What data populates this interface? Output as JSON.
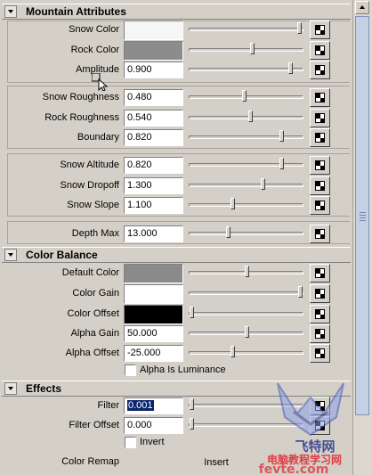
{
  "sections": {
    "mountain": "Mountain Attributes",
    "color_balance": "Color Balance",
    "effects": "Effects"
  },
  "mountain": {
    "snow_color": {
      "label": "Snow Color",
      "color": "#f6f6f6",
      "slider": 0.98
    },
    "rock_color": {
      "label": "Rock Color",
      "color": "#8c8c8c",
      "slider": 0.55
    },
    "amplitude": {
      "label": "Amplitude",
      "value": "0.900",
      "slider": 0.9
    },
    "snow_roughness": {
      "label": "Snow Roughness",
      "value": "0.480",
      "slider": 0.48
    },
    "rock_roughness": {
      "label": "Rock Roughness",
      "value": "0.540",
      "slider": 0.54
    },
    "boundary": {
      "label": "Boundary",
      "value": "0.820",
      "slider": 0.82
    },
    "snow_altitude": {
      "label": "Snow Altitude",
      "value": "0.820",
      "slider": 0.82
    },
    "snow_dropoff": {
      "label": "Snow Dropoff",
      "value": "1.300",
      "slider": 0.65
    },
    "snow_slope": {
      "label": "Snow Slope",
      "value": "1.100",
      "slider": 0.37
    },
    "depth_max": {
      "label": "Depth Max",
      "value": "13.000",
      "slider": 0.33
    }
  },
  "color_balance": {
    "default_color": {
      "label": "Default Color",
      "color": "#8a8a8a",
      "slider": 0.5
    },
    "color_gain": {
      "label": "Color Gain",
      "color": "#ffffff",
      "slider": 0.99
    },
    "color_offset": {
      "label": "Color Offset",
      "color": "#000000",
      "slider": 0.0
    },
    "alpha_gain": {
      "label": "Alpha Gain",
      "value": "50.000",
      "slider": 0.5
    },
    "alpha_offset": {
      "label": "Alpha Offset",
      "value": "-25.000",
      "slider": 0.37
    },
    "alpha_is_luminance": {
      "label": "Alpha Is Luminance",
      "checked": false
    }
  },
  "effects": {
    "filter": {
      "label": "Filter",
      "value": "0.001",
      "slider": 0.0
    },
    "filter_offset": {
      "label": "Filter Offset",
      "value": "0.000",
      "slider": 0.0
    },
    "invert": {
      "label": "Invert",
      "checked": false
    },
    "color_remap": {
      "label": "Color Remap",
      "button": "Insert"
    }
  },
  "watermark": {
    "line1": "飞特网",
    "line2": "电脑教程学习网",
    "line3": "fevte.com"
  }
}
